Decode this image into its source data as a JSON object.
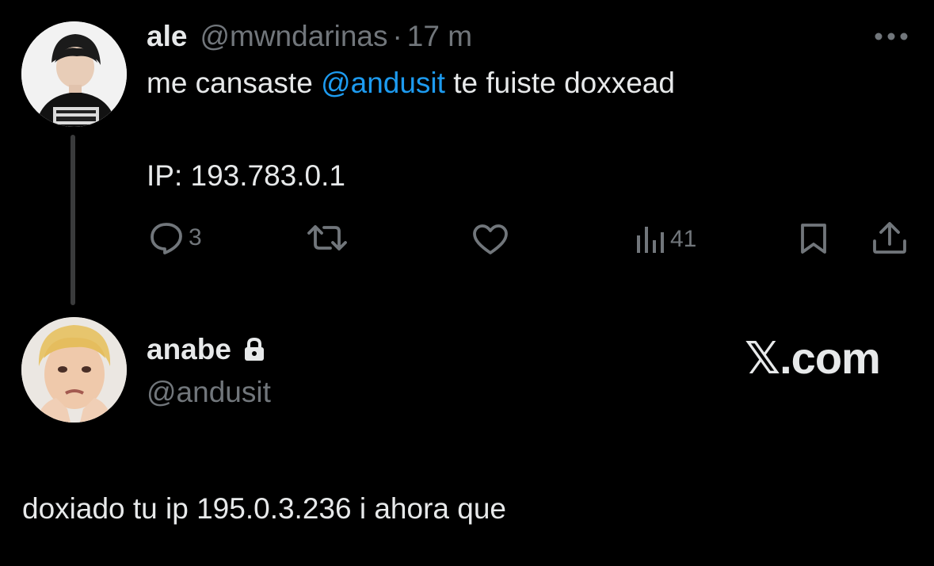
{
  "tweet": {
    "author_name": "ale",
    "author_handle": "@mwndarinas",
    "separator": "·",
    "time": "17 m",
    "text_before_mention": "me cansaste ",
    "mention": "@andusit",
    "text_after_mention": " te fuiste doxxead",
    "text_line2": "IP: 193.783.0.1",
    "actions": {
      "reply_count": "3",
      "views_count": "41"
    },
    "icons": [
      "more-icon",
      "reply-icon",
      "retweet-icon",
      "like-icon",
      "views-icon",
      "bookmark-icon",
      "share-icon"
    ]
  },
  "reply": {
    "author_name": "anabe",
    "author_handle": "@andusit",
    "text": "doxiado tu ip 195.0.3.236 i ahora que",
    "icons": [
      "lock-icon"
    ]
  },
  "watermark": "𝕏.com",
  "colors": {
    "background": "#000000",
    "text": "#e7e9ea",
    "secondary": "#71767b",
    "mention": "#1d9bf0"
  }
}
